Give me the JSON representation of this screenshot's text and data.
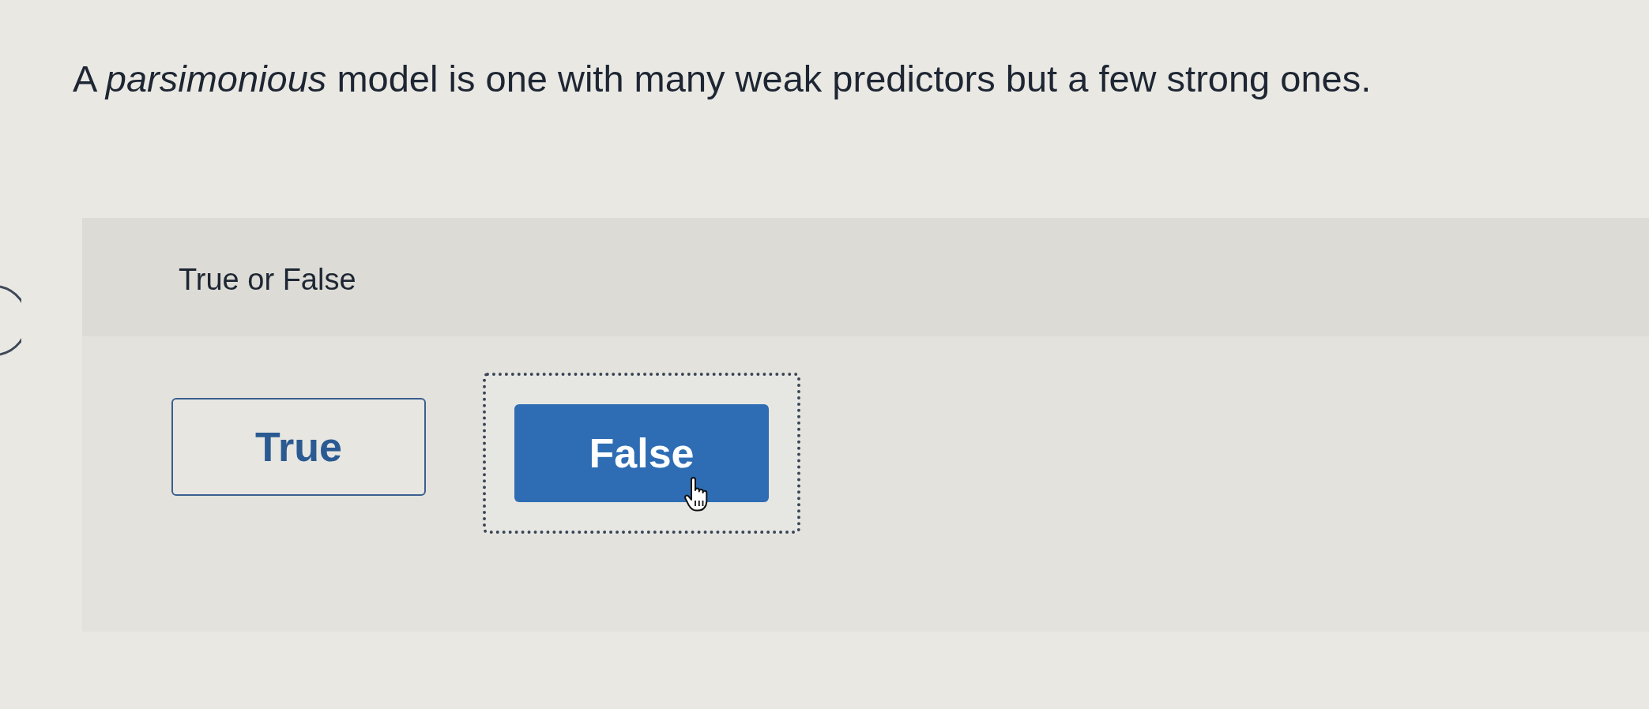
{
  "question": {
    "text": "A *parsimonious* model is one with many weak predictors but a few strong ones."
  },
  "answer_panel": {
    "prompt": "True or False",
    "options": [
      {
        "label": "True",
        "selected": false
      },
      {
        "label": "False",
        "selected": true
      }
    ]
  }
}
